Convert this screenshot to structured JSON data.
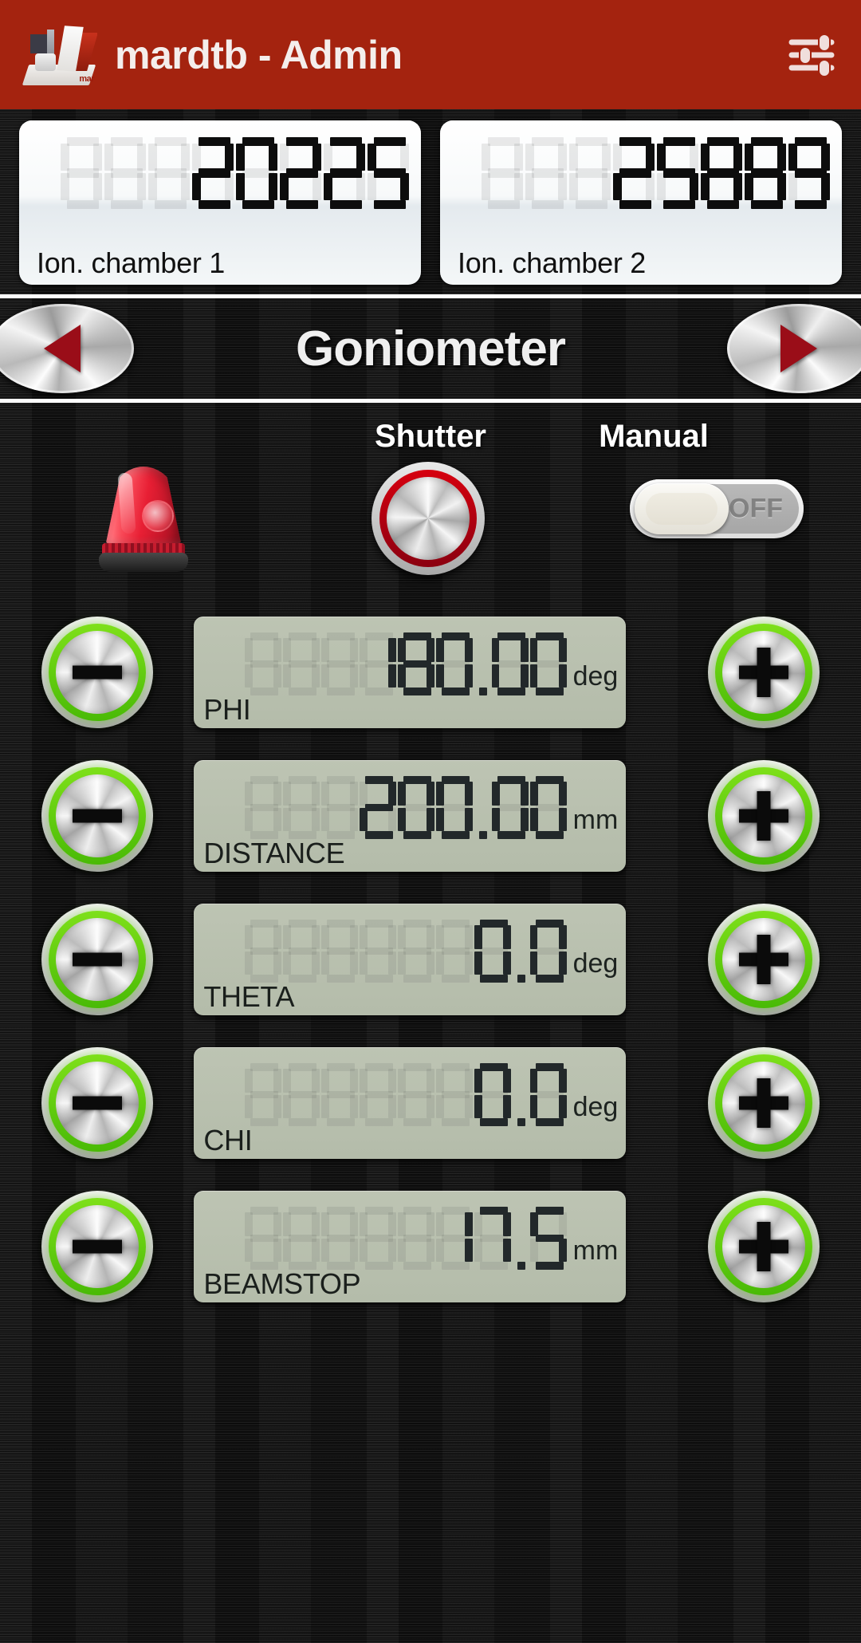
{
  "header": {
    "title": "mardtb - Admin",
    "logo_icon": "instrument-photo-logo",
    "logo_brand": "mar",
    "settings_icon": "sliders-settings-icon",
    "bg_color": "#a4230f"
  },
  "ion_chambers": [
    {
      "label": "Ion. chamber 1",
      "value": "20225",
      "digit_count": 8
    },
    {
      "label": "Ion. chamber 2",
      "value": "25889",
      "digit_count": 8
    }
  ],
  "nav": {
    "title": "Goniometer",
    "prev_icon": "arrow-left-icon",
    "next_icon": "arrow-right-icon",
    "accent_color": "#9a0d18"
  },
  "controls": {
    "beacon_icon": "warning-beacon-light-icon",
    "shutter_label": "Shutter",
    "shutter_icon": "shutter-round-button-icon",
    "manual_label": "Manual",
    "manual_state": "OFF"
  },
  "parameters": [
    {
      "name": "PHI",
      "value": "180.00",
      "unit": "deg",
      "digit_count": 8,
      "minus_icon": "minus-icon",
      "plus_icon": "plus-icon"
    },
    {
      "name": "DISTANCE",
      "value": "200.00",
      "unit": "mm",
      "digit_count": 8,
      "minus_icon": "minus-icon",
      "plus_icon": "plus-icon"
    },
    {
      "name": "THETA",
      "value": "0.0",
      "unit": "deg",
      "digit_count": 8,
      "minus_icon": "minus-icon",
      "plus_icon": "plus-icon"
    },
    {
      "name": "CHI",
      "value": "0.0",
      "unit": "deg",
      "digit_count": 8,
      "minus_icon": "minus-icon",
      "plus_icon": "plus-icon"
    },
    {
      "name": "BEAMSTOP",
      "value": "17.5",
      "unit": "mm",
      "digit_count": 8,
      "minus_icon": "minus-icon",
      "plus_icon": "plus-icon"
    }
  ],
  "theme": {
    "lcd_bg": "#bdc4b3",
    "lcd_fg": "#22282a",
    "button_ring_green": "#5ecd0c",
    "shutter_ring_red": "#c10010"
  }
}
